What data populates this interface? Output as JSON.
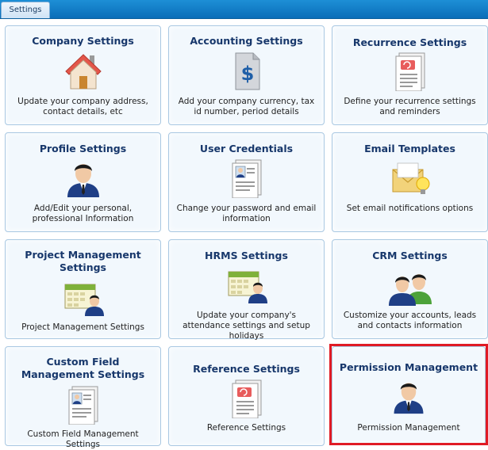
{
  "tab": {
    "label": "Settings"
  },
  "cards": [
    {
      "title": "Company Settings",
      "desc": "Update your company address, contact details, etc",
      "icon": "house-icon"
    },
    {
      "title": "Accounting Settings",
      "desc": "Add your company currency, tax id number, period details",
      "icon": "dollar-document-icon"
    },
    {
      "title": "Recurrence Settings",
      "desc": "Define your recurrence settings and reminders",
      "icon": "recurrence-document-icon"
    },
    {
      "title": "Profile Settings",
      "desc": "Add/Edit your personal, professional Information",
      "icon": "user-icon"
    },
    {
      "title": "User Credentials",
      "desc": "Change your password and email information",
      "icon": "credentials-document-icon"
    },
    {
      "title": "Email Templates",
      "desc": "Set email notifications options",
      "icon": "email-bulb-icon"
    },
    {
      "title": "Project Management Settings",
      "desc": "Project Management Settings",
      "icon": "calendar-user-icon"
    },
    {
      "title": "HRMS Settings",
      "desc": "Update your company's attendance settings and setup holidays",
      "icon": "calendar-user-icon"
    },
    {
      "title": "CRM Settings",
      "desc": "Customize your accounts, leads and contacts information",
      "icon": "users-group-icon"
    },
    {
      "title": "Custom Field Management Settings",
      "desc": "Custom Field Management Settings",
      "icon": "credentials-document-icon"
    },
    {
      "title": "Reference Settings",
      "desc": "Reference Settings",
      "icon": "recurrence-document-icon"
    },
    {
      "title": "Permission Management",
      "desc": "Permission Management",
      "icon": "user-icon"
    }
  ],
  "colors": {
    "highlight": "#e01b24",
    "title": "#17376b",
    "tabbar": "#0a6db8"
  }
}
